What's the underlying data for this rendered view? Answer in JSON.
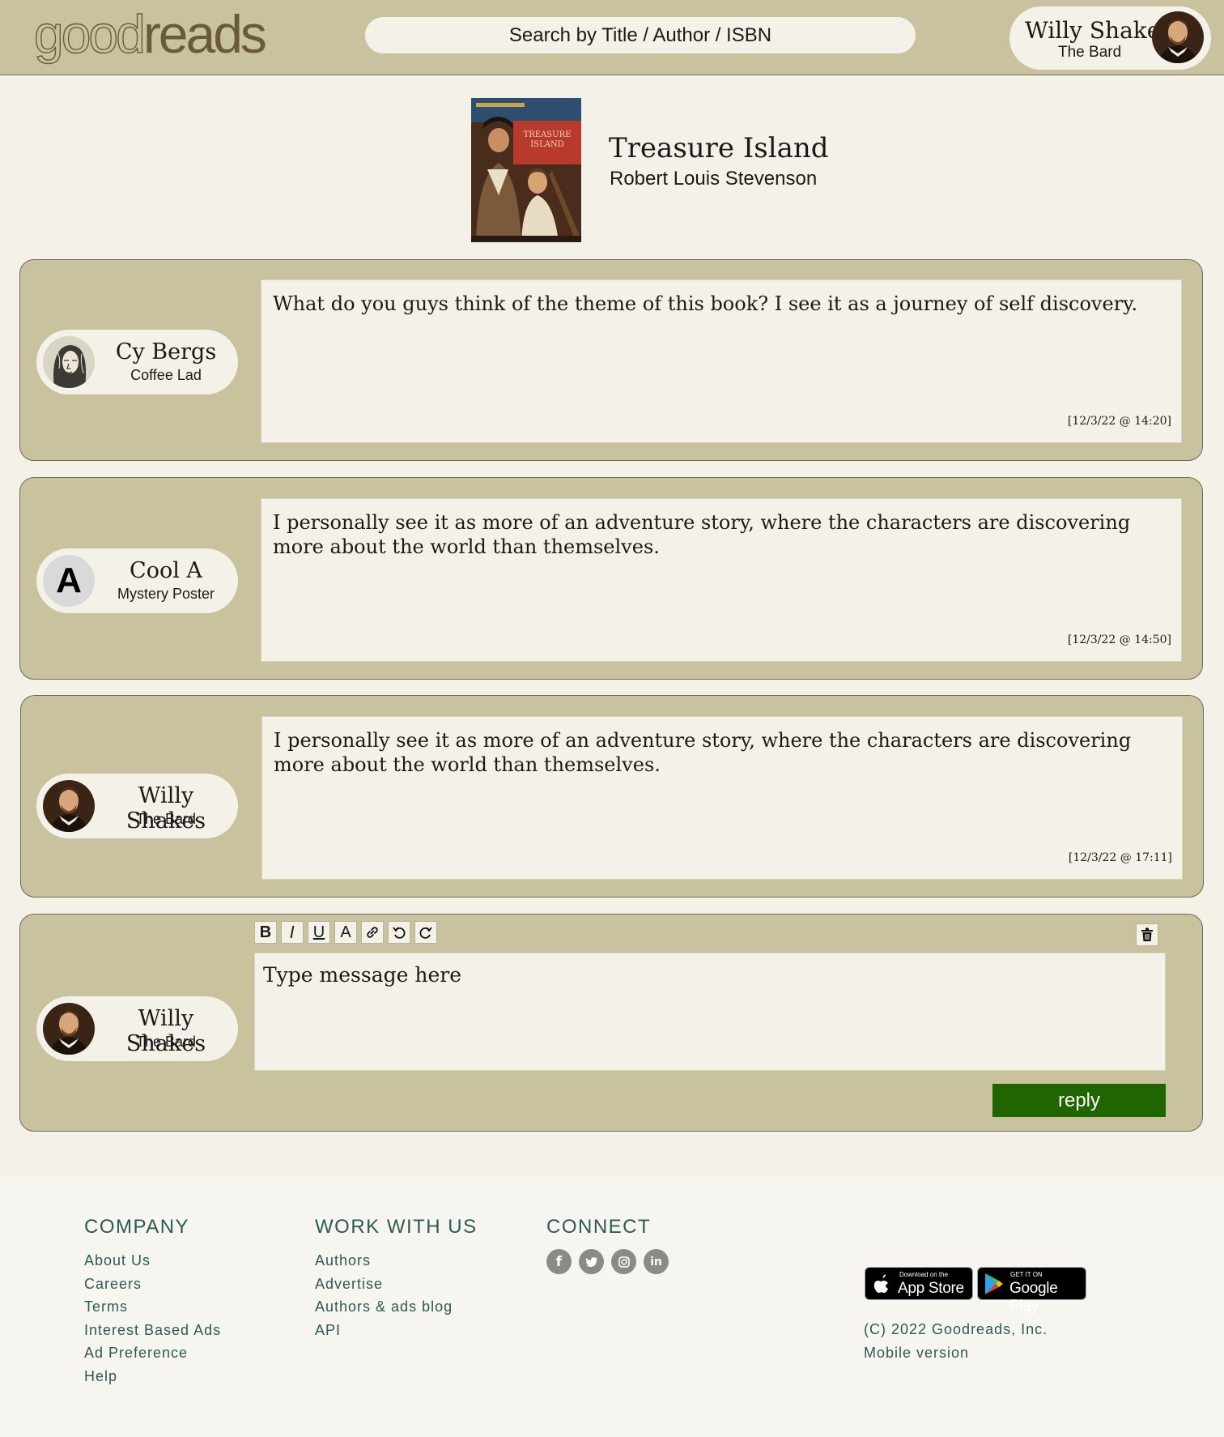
{
  "header": {
    "logo_good": "good",
    "logo_reads": "reads",
    "search_placeholder": "Search by Title / Author / ISBN",
    "user": {
      "name": "Willy Shakes",
      "subtitle": "The Bard"
    }
  },
  "book": {
    "title": "Treasure Island",
    "author": "Robert Louis Stevenson",
    "cover_text": "TREASURE ISLAND"
  },
  "posts": [
    {
      "author": "Cy Bergs",
      "subtitle": "Coffee Lad",
      "avatar": "engraving-portrait",
      "text": "What do you guys think of the theme of this book? I see it as a journey of self discovery.",
      "timestamp": "[12/3/22 @ 14:20]"
    },
    {
      "author": "Cool A",
      "subtitle": "Mystery Poster",
      "avatar": "letter-a",
      "avatar_letter": "A",
      "text": "I personally see it as more of an adventure story, where the characters are discovering more about the world than themselves.",
      "timestamp": "[12/3/22 @ 14:50]"
    },
    {
      "author": "Willy Shakes",
      "subtitle": "The Bard",
      "avatar": "shakespeare-portrait",
      "text": "I personally see it as more of an adventure story, where the characters are discovering more about the world than themselves.",
      "timestamp": "[12/3/22 @ 17:11]"
    }
  ],
  "reply": {
    "author": "Willy Shakes",
    "subtitle": "The Bard",
    "placeholder": "Type message here",
    "button": "reply",
    "toolbar": [
      "B",
      "I",
      "U",
      "A",
      "link-icon",
      "undo-icon",
      "redo-icon"
    ]
  },
  "footer": {
    "company": {
      "heading": "COMPANY",
      "links": [
        "About Us",
        "Careers",
        "Terms",
        "Interest Based Ads",
        "Ad Preference",
        "Help"
      ]
    },
    "work": {
      "heading": "WORK WITH US",
      "links": [
        "Authors",
        "Advertise",
        "Authors & ads blog",
        "API"
      ]
    },
    "connect": {
      "heading": "CONNECT",
      "icons": [
        "facebook-icon",
        "twitter-icon",
        "instagram-icon",
        "linkedin-icon"
      ]
    },
    "app_store": {
      "small": "Download on the",
      "big": "App Store"
    },
    "google_play": {
      "small": "GET IT ON",
      "big": "Google Play"
    },
    "copyright": "(C) 2022 Goodreads, Inc.",
    "mobile": "Mobile version"
  },
  "colors": {
    "background": "#f4f1e8",
    "panel": "#c8c39e",
    "reply_button": "#1f6500",
    "footer_link": "#2d5a55",
    "logo": "#6a5a3c"
  }
}
